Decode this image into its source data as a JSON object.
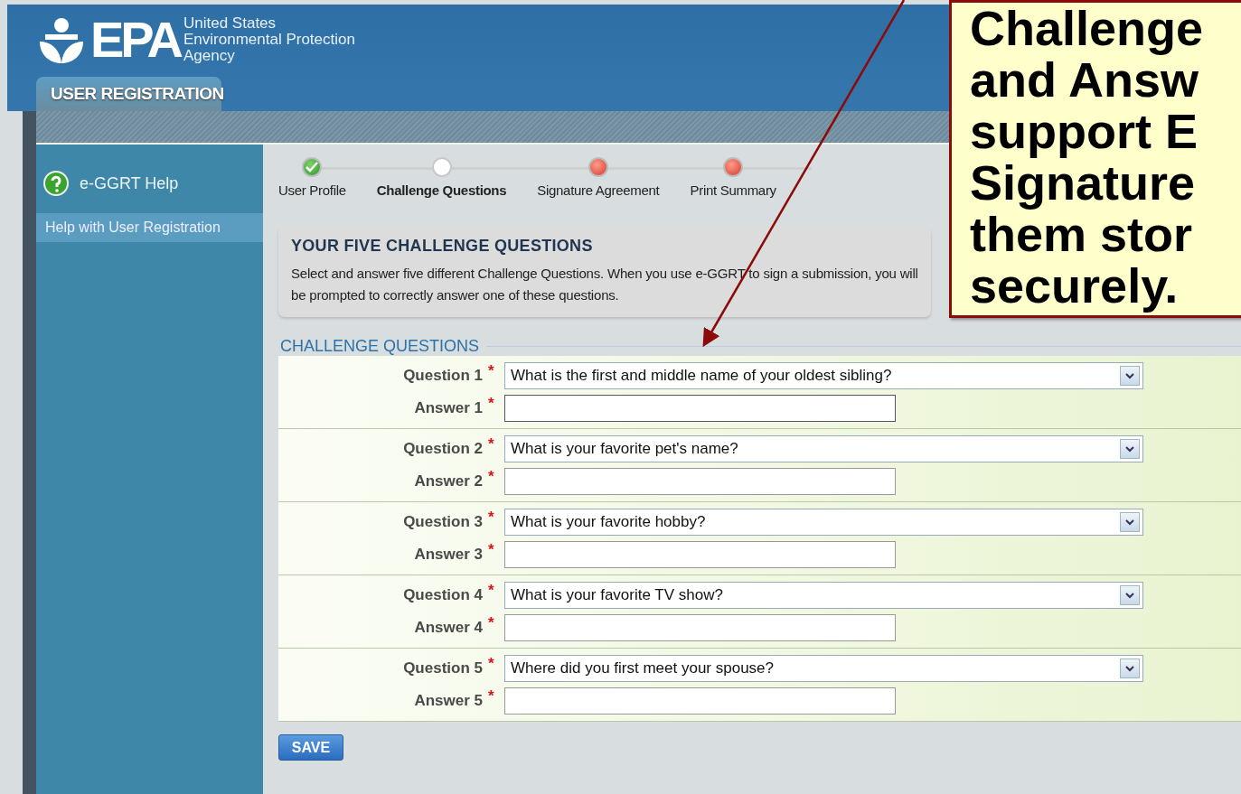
{
  "header": {
    "logo_text": "EPA",
    "agency_lines": [
      "United States",
      "Environmental Protection",
      "Agency"
    ],
    "tab": "USER REGISTRATION"
  },
  "sidebar": {
    "help_title": "e-GGRT Help",
    "items": [
      {
        "label": "Help with User Registration",
        "selected": true
      }
    ]
  },
  "steps": [
    {
      "label": "User Profile",
      "kind": "done",
      "selected": false
    },
    {
      "label": "Challenge Questions",
      "kind": "current",
      "selected": true
    },
    {
      "label": "Signature Agreement",
      "kind": "pending",
      "selected": false
    },
    {
      "label": "Print Summary",
      "kind": "pending",
      "selected": false
    }
  ],
  "intro": {
    "title": "YOUR FIVE CHALLENGE QUESTIONS",
    "text": "Select and answer five different Challenge Questions. When you use e-GGRT to sign a submission, you will be prompted to correctly answer one of these questions."
  },
  "section_title": "CHALLENGE QUESTIONS",
  "groups": [
    {
      "question_label": "Question 1",
      "answer_label": "Answer 1",
      "required_mark": "*",
      "question": "What is the first and middle name of your oldest sibling?",
      "focused": true
    },
    {
      "question_label": "Question 2",
      "answer_label": "Answer 2",
      "required_mark": "*",
      "question": "What is your favorite pet's name?",
      "focused": false
    },
    {
      "question_label": "Question 3",
      "answer_label": "Answer 3",
      "required_mark": "*",
      "question": "What is your favorite hobby?",
      "focused": false
    },
    {
      "question_label": "Question 4",
      "answer_label": "Answer 4",
      "required_mark": "*",
      "question": "What is your favorite TV show?",
      "focused": false
    },
    {
      "question_label": "Question 5",
      "answer_label": "Answer 5",
      "required_mark": "*",
      "question": "Where did you first meet your spouse?",
      "focused": false
    }
  ],
  "save_button": "SAVE",
  "callout": {
    "lines": [
      "Challenge",
      "and Answ",
      "support E",
      "Signature",
      "them stor",
      "securely."
    ]
  }
}
